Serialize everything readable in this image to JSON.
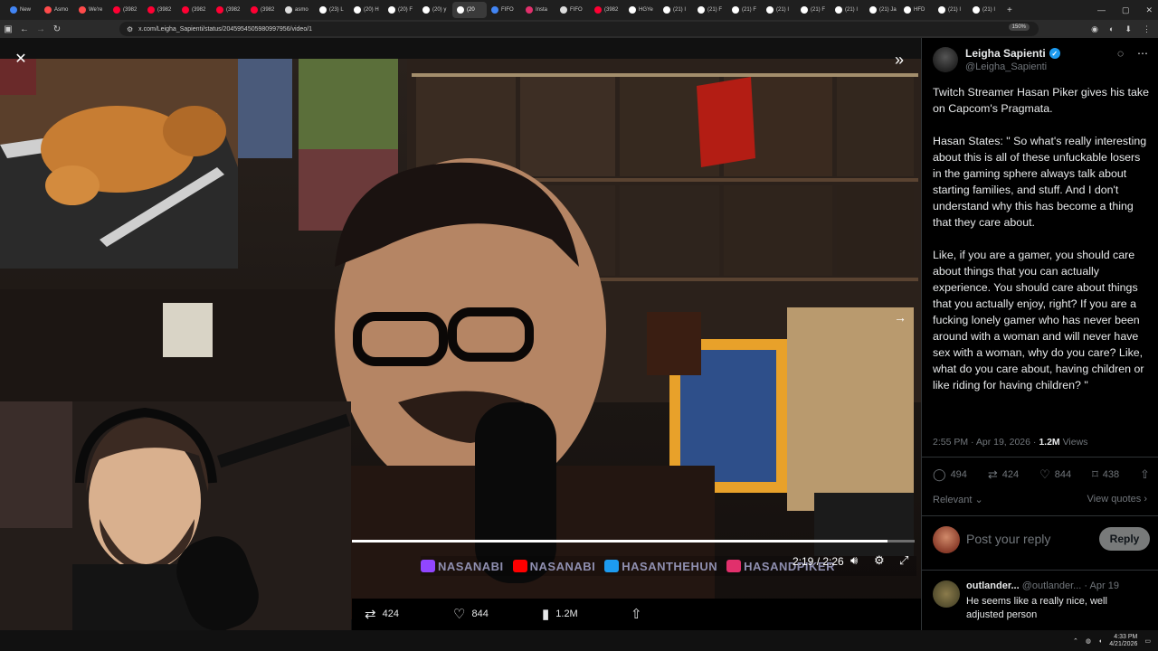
{
  "browser": {
    "tabs": [
      {
        "label": "New",
        "color": "#4285f4"
      },
      {
        "label": "Asmo",
        "color": "#ff4b4b"
      },
      {
        "label": "We're",
        "color": "#ff4b4b"
      },
      {
        "label": "(3982",
        "color": "#ff0033"
      },
      {
        "label": "(3982",
        "color": "#ff0033"
      },
      {
        "label": "(3982",
        "color": "#ff0033"
      },
      {
        "label": "(3982",
        "color": "#ff0033"
      },
      {
        "label": "(3982",
        "color": "#ff0033"
      },
      {
        "label": "asmo",
        "color": "#dddddd"
      },
      {
        "label": "(23) L",
        "color": "#ffffff"
      },
      {
        "label": "(20) H",
        "color": "#ffffff"
      },
      {
        "label": "(20) F",
        "color": "#ffffff"
      },
      {
        "label": "(20) y",
        "color": "#ffffff"
      },
      {
        "label": "(20",
        "color": "#ffffff"
      },
      {
        "label": "FIFO",
        "color": "#4285f4"
      },
      {
        "label": "Insta",
        "color": "#e1306c"
      },
      {
        "label": "FIFO",
        "color": "#dddddd"
      },
      {
        "label": "(3982",
        "color": "#ff0033"
      },
      {
        "label": "HGYe",
        "color": "#ffffff"
      },
      {
        "label": "(21) I",
        "color": "#ffffff"
      },
      {
        "label": "(21) F",
        "color": "#ffffff"
      },
      {
        "label": "(21) F",
        "color": "#ffffff"
      },
      {
        "label": "(21) I",
        "color": "#ffffff"
      },
      {
        "label": "(21) F",
        "color": "#ffffff"
      },
      {
        "label": "(21) I",
        "color": "#ffffff"
      },
      {
        "label": "(21) Ja",
        "color": "#ffffff"
      },
      {
        "label": "HFD",
        "color": "#ffffff"
      },
      {
        "label": "(21) I",
        "color": "#ffffff"
      },
      {
        "label": "(21) I",
        "color": "#ffffff"
      }
    ],
    "active_tab_index": 13,
    "url": "x.com/Leigha_Sapienti/status/2045954505980997956/video/1",
    "zoom": "150%"
  },
  "video": {
    "current_time": "2:19",
    "duration": "2:26",
    "time_display": "2:19 / 2:26",
    "progress_fraction": 0.9521,
    "watermark": [
      "NASANABI",
      "NASANABI",
      "HASANTHEHUN",
      "HASANDPIKER"
    ],
    "actions": {
      "reposts": "424",
      "likes": "844",
      "views": "1.2M"
    }
  },
  "post": {
    "display_name": "Leigha Sapienti",
    "handle": "@Leigha_Sapienti",
    "paragraphs": [
      "Twitch Streamer Hasan Piker gives his take on Capcom's Pragmata.",
      "Hasan States: \" So what's really interesting about this is all of these unfuckable losers in the gaming sphere always talk about starting families, and stuff. And I don't understand why this has become a thing that they care about.",
      "Like, if you are a gamer, you should care about things that you can actually experience. You should care about things that you actually enjoy, right? If you are a fucking lonely gamer who has never been around with a woman and will never have sex with a woman, why do you care? Like, what do you care about, having children or like riding for having children? \""
    ],
    "timestamp": "2:55 PM · Apr 19, 2026 · ",
    "views_count": "1.2M",
    "views_label": " Views",
    "replies": "494",
    "reposts": "424",
    "likes": "844",
    "bookmarks": "438",
    "relevant_label": "Relevant",
    "view_quotes_label": "View quotes"
  },
  "reply_box": {
    "placeholder": "Post your reply",
    "button": "Reply"
  },
  "comment": {
    "name": "outlander...",
    "handle": "@outlander...",
    "date": "· Apr 19",
    "text": "He seems like a really nice, well adjusted person"
  },
  "taskbar": {
    "time": "4:33 PM",
    "date": "4/21/2026"
  },
  "colors": {
    "accent": "#1d9bf0",
    "background": "#000000",
    "muted": "#71767b"
  }
}
